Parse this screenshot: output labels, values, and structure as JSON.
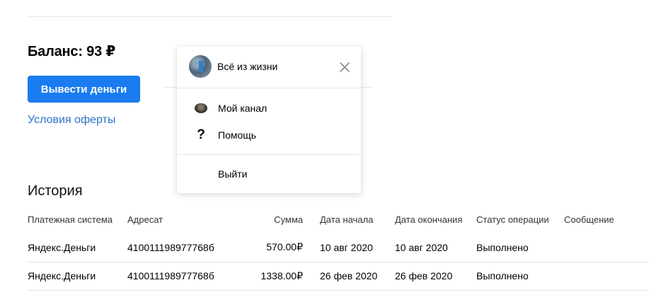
{
  "balance": {
    "label": "Баланс: 93 ₽"
  },
  "actions": {
    "withdraw_label": "Вывести деньги",
    "terms_label": "Условия оферты"
  },
  "history": {
    "title": "История",
    "columns": [
      "Платежная система",
      "Адресат",
      "Сумма",
      "Дата начала",
      "Дата окончания",
      "Статус операции",
      "Сообщение"
    ],
    "rows": [
      [
        "Яндекс.Деньги",
        "410011198977768б",
        "570.00₽",
        "10 авг 2020",
        "10 авг 2020",
        "Выполнено",
        ""
      ],
      [
        "Яндекс.Деньги",
        "410011198977768б",
        "1338.00₽",
        "26 фев 2020",
        "26 фев 2020",
        "Выполнено",
        ""
      ]
    ]
  },
  "popup": {
    "account_name": "Всё из жизни",
    "avatar_icon": "user-avatar-icon",
    "close_icon": "close-icon",
    "items": [
      {
        "label": "Мой канал",
        "icon": "channel-avatar-icon"
      },
      {
        "label": "Помощь",
        "icon": "question-icon"
      }
    ],
    "logout_label": "Выйти"
  },
  "colors": {
    "accent": "#1a7cf0",
    "link": "#2b73c4",
    "divider": "#e6e6e6"
  }
}
